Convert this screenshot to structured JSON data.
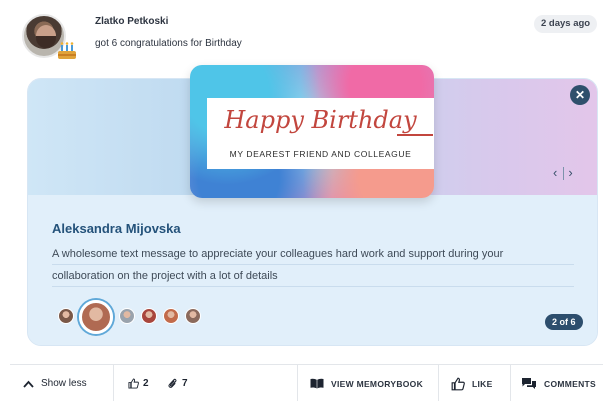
{
  "post": {
    "author": "Zlatko Petkoski",
    "activity": "got 6 congratulations for Birthday",
    "time": "2 days ago"
  },
  "card": {
    "image_title": "Happy Birthday",
    "image_subtitle": "MY DEAREST FRIEND AND COLLEAGUE",
    "recipient": "Aleksandra Mijovska",
    "message_line1": "A wholesome text message to appreciate your colleagues hard work and support during your",
    "message_line2": "collaboration on the project with a lot of details",
    "close_glyph": "✕",
    "prev_glyph": "‹",
    "next_glyph": "›",
    "counter": "2 of 6"
  },
  "participants": [
    {
      "color": "#7a5848"
    },
    {
      "color": "#b06a52"
    },
    {
      "color": "#9aa3ad"
    },
    {
      "color": "#a8463d"
    },
    {
      "color": "#c26b4b"
    },
    {
      "color": "#8b6a5c"
    }
  ],
  "actions": {
    "show_less": "Show less",
    "likes_count": "2",
    "attachments_count": "7",
    "memorybook": "VIEW MEMORYBOOK",
    "like": "LIKE",
    "comments": "COMMENTS"
  },
  "icons": {
    "caret": "chevron-up-icon",
    "thumbs": "thumbs-up-icon",
    "clip": "paperclip-icon",
    "book": "book-icon",
    "chat": "comments-icon"
  },
  "colors": {
    "accent": "#24527a",
    "badge": "#2d4e6d",
    "title_red": "#c2463e"
  }
}
